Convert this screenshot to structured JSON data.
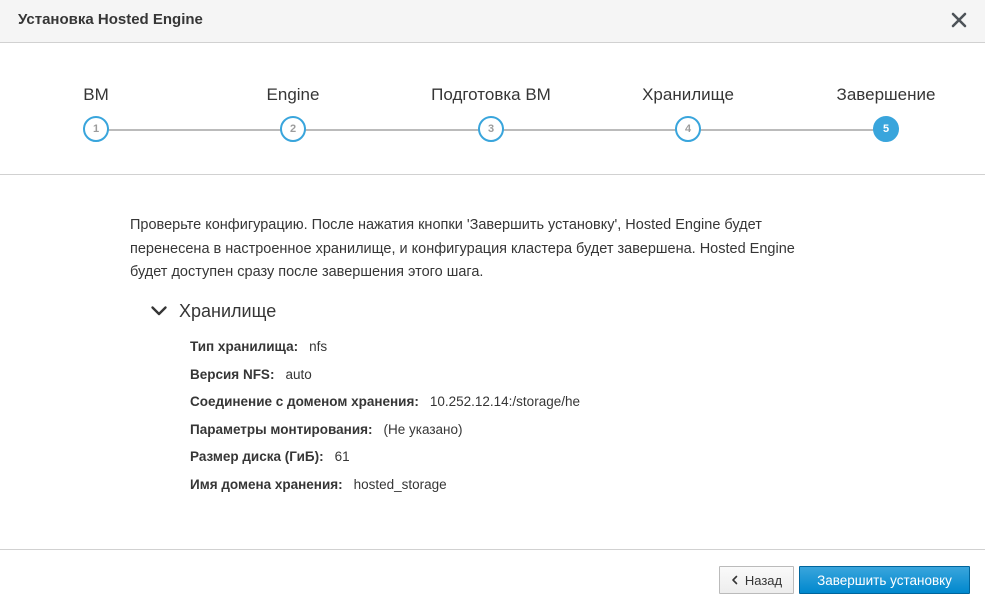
{
  "dialog": {
    "title": "Установка Hosted Engine"
  },
  "steps": [
    {
      "label": "ВМ",
      "number": "1"
    },
    {
      "label": "Engine",
      "number": "2"
    },
    {
      "label": "Подготовка ВМ",
      "number": "3"
    },
    {
      "label": "Хранилище",
      "number": "4"
    },
    {
      "label": "Завершение",
      "number": "5"
    }
  ],
  "active_step": 5,
  "intro": {
    "line1": "Проверьте конфигурацию. После нажатия кнопки 'Завершить установку', Hosted Engine будет",
    "line2": "перенесена в настроенное хранилище, и конфигурация кластера будет завершена. Hosted Engine",
    "line3": "будет доступен сразу после завершения этого шага."
  },
  "section": {
    "title": "Хранилище",
    "rows": [
      {
        "label": "Тип хранилища:",
        "value": "nfs"
      },
      {
        "label": "Версия NFS:",
        "value": "auto"
      },
      {
        "label": "Соединение с доменом хранения:",
        "value": "10.252.12.14:/storage/he"
      },
      {
        "label": "Параметры монтирования:",
        "value": "(Не указано)"
      },
      {
        "label": "Размер диска (ГиБ):",
        "value": "61"
      },
      {
        "label": "Имя домена хранения:",
        "value": "hosted_storage"
      }
    ]
  },
  "footer": {
    "back_label": "Назад",
    "finish_label": "Завершить установку"
  },
  "colors": {
    "accent": "#39a5dc",
    "primary_button": "#0088ce"
  },
  "icons": {
    "close": "close-icon",
    "section_toggle": "chevron-down-icon",
    "back": "chevron-left-icon"
  }
}
